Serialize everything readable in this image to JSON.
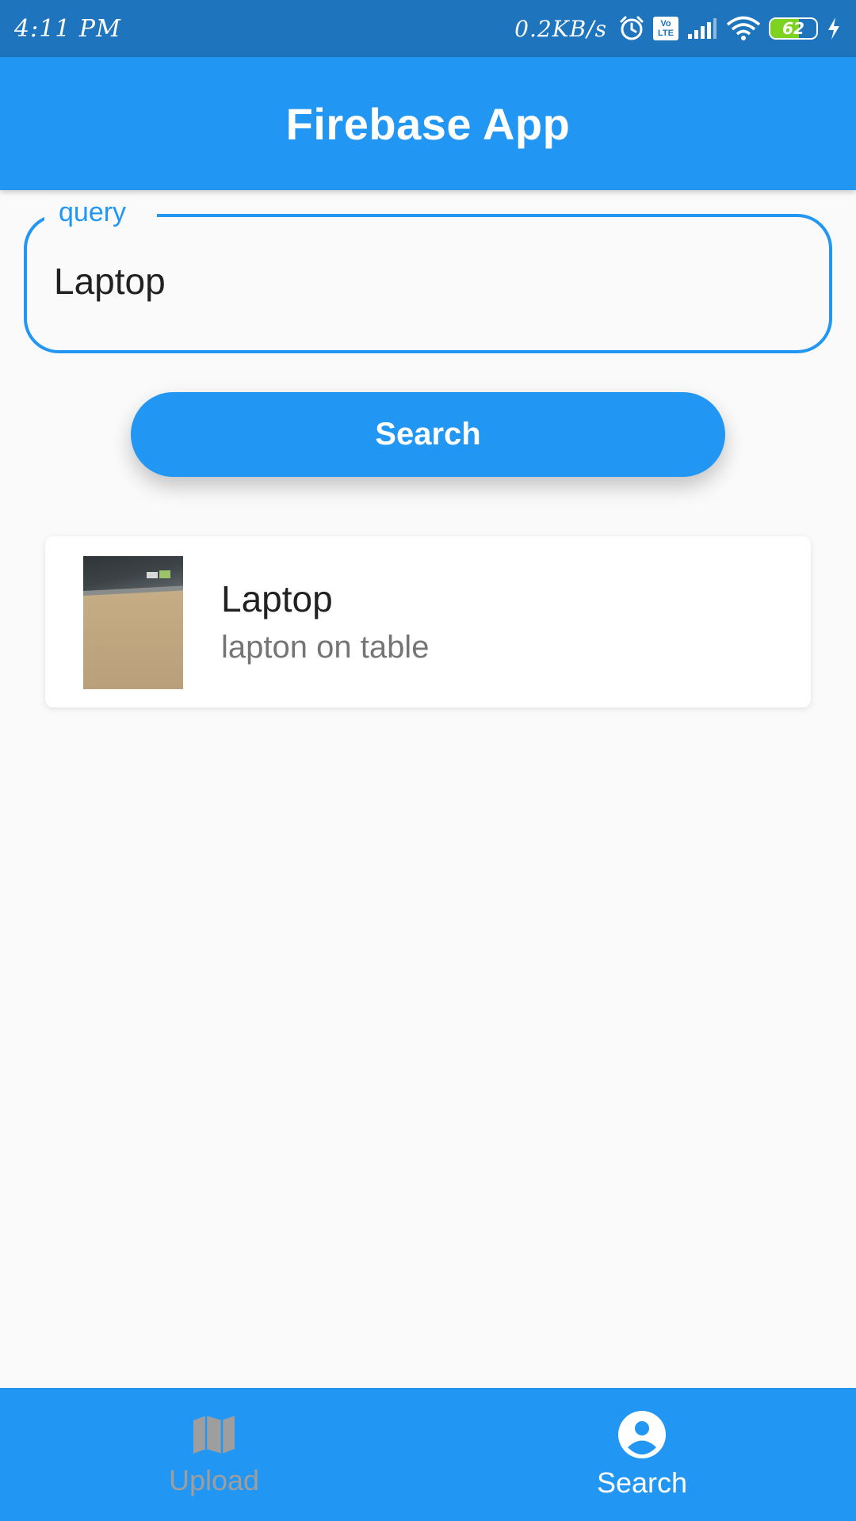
{
  "status_bar": {
    "time": "4:11 PM",
    "network_speed": "0.2KB/s",
    "volte_top": "Vo",
    "volte_bottom": "LTE",
    "battery_level": "62",
    "icons": [
      "alarm-icon",
      "volte-icon",
      "signal-icon",
      "wifi-icon",
      "battery-icon",
      "charging-icon"
    ]
  },
  "app_bar": {
    "title": "Firebase App"
  },
  "query_field": {
    "label": "query",
    "value": "Laptop"
  },
  "search_button": {
    "label": "Search"
  },
  "results": [
    {
      "title": "Laptop",
      "subtitle": "lapton on table"
    }
  ],
  "bottom_nav": {
    "items": [
      {
        "label": "Upload",
        "icon": "map-icon",
        "active": false
      },
      {
        "label": "Search",
        "icon": "account-circle-icon",
        "active": true
      }
    ]
  },
  "colors": {
    "primary": "#2196f3",
    "status_bar": "#1e75bd",
    "background": "#fafafa",
    "inactive_nav": "#9e9e9e",
    "battery_fill": "#7ed321"
  }
}
